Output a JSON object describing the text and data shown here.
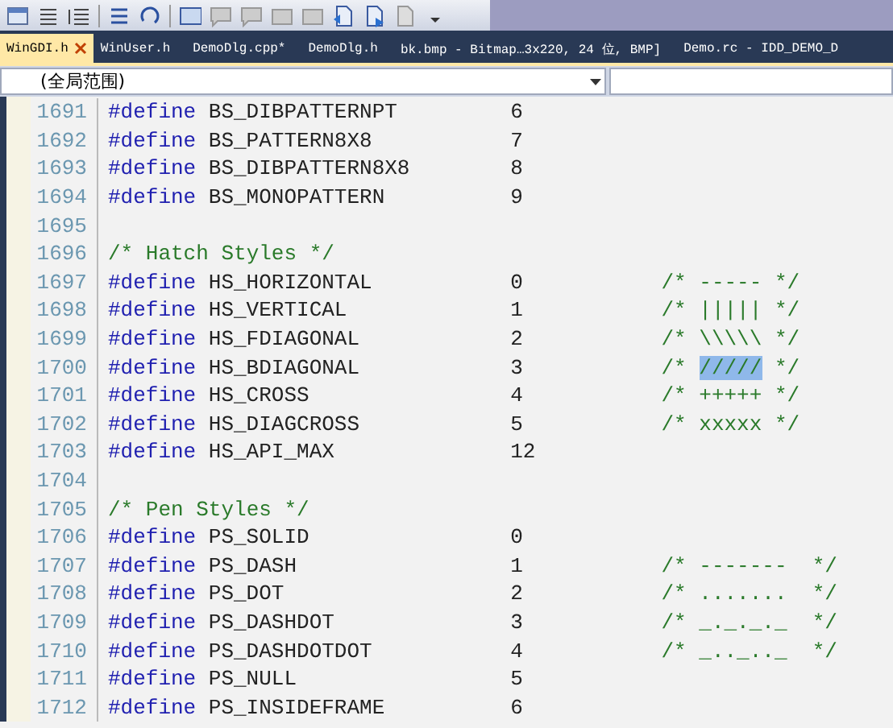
{
  "tabs": [
    {
      "label": "WinGDI.h",
      "selected": true,
      "closable": true
    },
    {
      "label": "WinUser.h",
      "selected": false,
      "closable": false
    },
    {
      "label": "DemoDlg.cpp*",
      "selected": false,
      "closable": false
    },
    {
      "label": "DemoDlg.h",
      "selected": false,
      "closable": false
    },
    {
      "label": "bk.bmp - Bitmap…3x220, 24 位, BMP]",
      "selected": false,
      "closable": false
    },
    {
      "label": "Demo.rc - IDD_DEMO_D",
      "selected": false,
      "closable": false
    }
  ],
  "scope_dropdown": {
    "value": "(全局范围)"
  },
  "code_lines": [
    {
      "number": "1691",
      "kind": "define",
      "directive": "#define",
      "name": "BS_DIBPATTERNPT",
      "value": "6"
    },
    {
      "number": "1692",
      "kind": "define",
      "directive": "#define",
      "name": "BS_PATTERN8X8",
      "value": "7"
    },
    {
      "number": "1693",
      "kind": "define",
      "directive": "#define",
      "name": "BS_DIBPATTERN8X8",
      "value": "8"
    },
    {
      "number": "1694",
      "kind": "define",
      "directive": "#define",
      "name": "BS_MONOPATTERN",
      "value": "9"
    },
    {
      "number": "1695",
      "kind": "blank"
    },
    {
      "number": "1696",
      "kind": "comment",
      "text": "/* Hatch Styles */"
    },
    {
      "number": "1697",
      "kind": "define",
      "directive": "#define",
      "name": "HS_HORIZONTAL",
      "value": "0",
      "comment": "/* ----- */"
    },
    {
      "number": "1698",
      "kind": "define",
      "directive": "#define",
      "name": "HS_VERTICAL",
      "value": "1",
      "comment": "/* ||||| */"
    },
    {
      "number": "1699",
      "kind": "define",
      "directive": "#define",
      "name": "HS_FDIAGONAL",
      "value": "2",
      "comment": "/* \\\\\\\\\\ */"
    },
    {
      "number": "1700",
      "kind": "define",
      "directive": "#define",
      "name": "HS_BDIAGONAL",
      "value": "3",
      "comment_parts": [
        {
          "text": "/* ",
          "selected": false
        },
        {
          "text": "/////",
          "selected": true
        },
        {
          "text": " */",
          "selected": false
        }
      ]
    },
    {
      "number": "1701",
      "kind": "define",
      "directive": "#define",
      "name": "HS_CROSS",
      "value": "4",
      "comment": "/* +++++ */"
    },
    {
      "number": "1702",
      "kind": "define",
      "directive": "#define",
      "name": "HS_DIAGCROSS",
      "value": "5",
      "comment": "/* xxxxx */"
    },
    {
      "number": "1703",
      "kind": "define",
      "directive": "#define",
      "name": "HS_API_MAX",
      "value": "12"
    },
    {
      "number": "1704",
      "kind": "blank"
    },
    {
      "number": "1705",
      "kind": "comment",
      "text": "/* Pen Styles */"
    },
    {
      "number": "1706",
      "kind": "define",
      "directive": "#define",
      "name": "PS_SOLID",
      "value": "0"
    },
    {
      "number": "1707",
      "kind": "define",
      "directive": "#define",
      "name": "PS_DASH",
      "value": "1",
      "comment": "/* -------  */"
    },
    {
      "number": "1708",
      "kind": "define",
      "directive": "#define",
      "name": "PS_DOT",
      "value": "2",
      "comment": "/* .......  */"
    },
    {
      "number": "1709",
      "kind": "define",
      "directive": "#define",
      "name": "PS_DASHDOT",
      "value": "3",
      "comment": "/* _._._._  */"
    },
    {
      "number": "1710",
      "kind": "define",
      "directive": "#define",
      "name": "PS_DASHDOTDOT",
      "value": "4",
      "comment": "/* _.._.._  */"
    },
    {
      "number": "1711",
      "kind": "define",
      "directive": "#define",
      "name": "PS_NULL",
      "value": "5"
    },
    {
      "number": "1712",
      "kind": "define",
      "directive": "#define",
      "name": "PS_INSIDEFRAME",
      "value": "6"
    }
  ]
}
